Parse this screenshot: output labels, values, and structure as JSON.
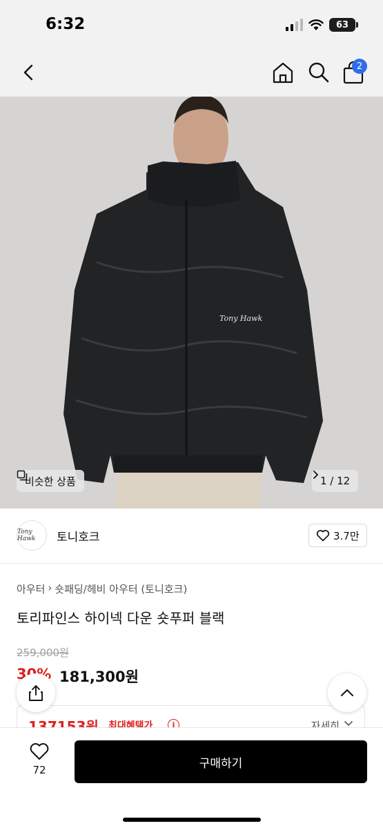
{
  "status_bar": {
    "time": "6:32",
    "battery": "63"
  },
  "nav": {
    "cart_count": "2"
  },
  "hero": {
    "similar_label": "비슷한 상품",
    "page_indicator": "1 / 12",
    "jacket_logo_text": "Tony Hawk"
  },
  "brand": {
    "logo_text": "Tony Hawk",
    "name": "토니호크",
    "likes": "3.7만"
  },
  "product": {
    "breadcrumb": [
      "아우터",
      "숏패딩/헤비 아우터 (토니호크)"
    ],
    "title": "토리파인스 하이넥 다운 숏푸퍼 블랙",
    "price_original": "259,000원",
    "discount": "30%",
    "price_final": "181,300원"
  },
  "benefit": {
    "amount": "137153원",
    "label": "최대혜택가",
    "detail_label": "자세히"
  },
  "bottom_bar": {
    "like_count": "72",
    "buy_label": "구매하기"
  },
  "colors": {
    "accent_red": "#e02020",
    "badge_blue": "#2f6ee8",
    "buy_button": "#000000"
  },
  "icons": [
    "back-icon",
    "home-icon",
    "search-icon",
    "cart-icon",
    "share-icon",
    "chevron-up-icon",
    "heart-icon",
    "info-icon",
    "similar-icon",
    "chevron-right-icon",
    "chevron-down-icon"
  ]
}
